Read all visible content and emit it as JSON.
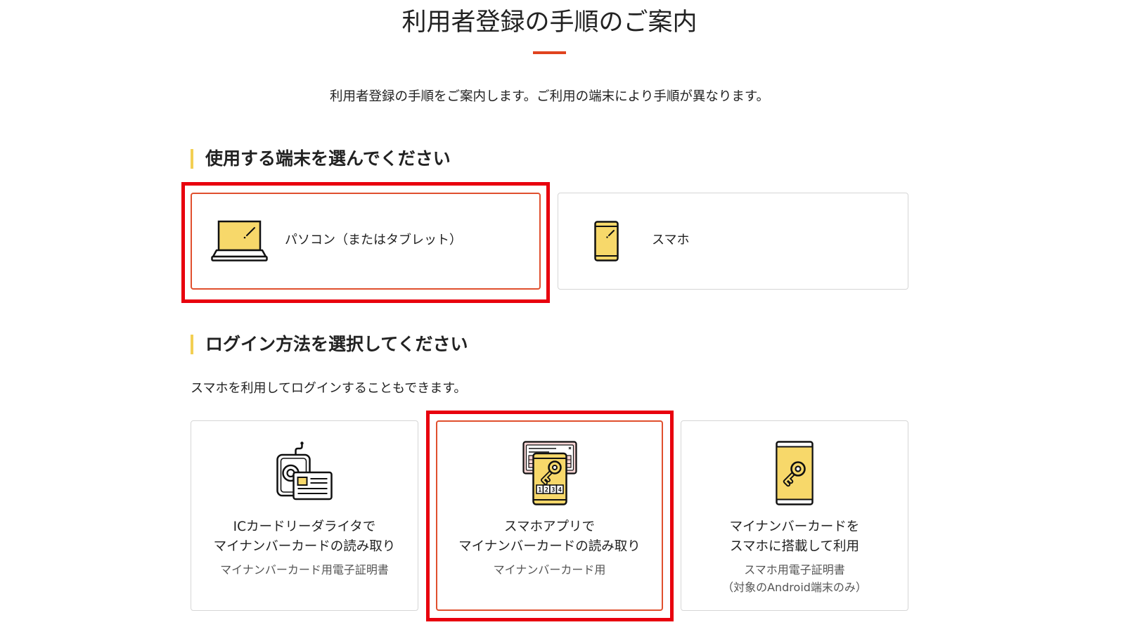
{
  "page": {
    "title": "利用者登録の手順のご案内",
    "lead": "利用者登録の手順をご案内します。ご利用の端末により手順が異なります。"
  },
  "device_section": {
    "heading": "使用する端末を選んでください",
    "options": [
      {
        "label": "パソコン（またはタブレット）",
        "icon": "laptop-icon",
        "selected": true,
        "highlighted": true
      },
      {
        "label": "スマホ",
        "icon": "smartphone-icon",
        "selected": false,
        "highlighted": false
      }
    ]
  },
  "login_section": {
    "heading": "ログイン方法を選択してください",
    "note": "スマホを利用してログインすることもできます。",
    "options": [
      {
        "title_lines": [
          "ICカードリーダライタで",
          "マイナンバーカードの読み取り"
        ],
        "sub_lines": [
          "マイナンバーカード用電子証明書"
        ],
        "icon": "ic-card-reader-icon",
        "selected": false,
        "highlighted": false
      },
      {
        "title_lines": [
          "スマホアプリで",
          "マイナンバーカードの読み取り"
        ],
        "sub_lines": [
          "マイナンバーカード用"
        ],
        "icon": "smartphone-card-reading-icon",
        "icon_pin_digits": [
          "1",
          "2",
          "3",
          "4"
        ],
        "selected": true,
        "highlighted": true
      },
      {
        "title_lines": [
          "マイナンバーカードを",
          "スマホに搭載して利用"
        ],
        "sub_lines": [
          "スマホ用電子証明書",
          "（対象のAndroid端末のみ）"
        ],
        "icon": "smartphone-key-icon",
        "selected": false,
        "highlighted": false
      }
    ]
  },
  "colors": {
    "text": "#222222",
    "sub_text": "#555555",
    "accent": "#e0431f",
    "selected_border": "#e0502e",
    "card_border": "#d6d6d6",
    "heading_bar": "#f3cf53",
    "icon_fill": "#f7d86a",
    "icon_card_fill": "#f6d3d3",
    "highlight_frame": "#e8000e"
  }
}
